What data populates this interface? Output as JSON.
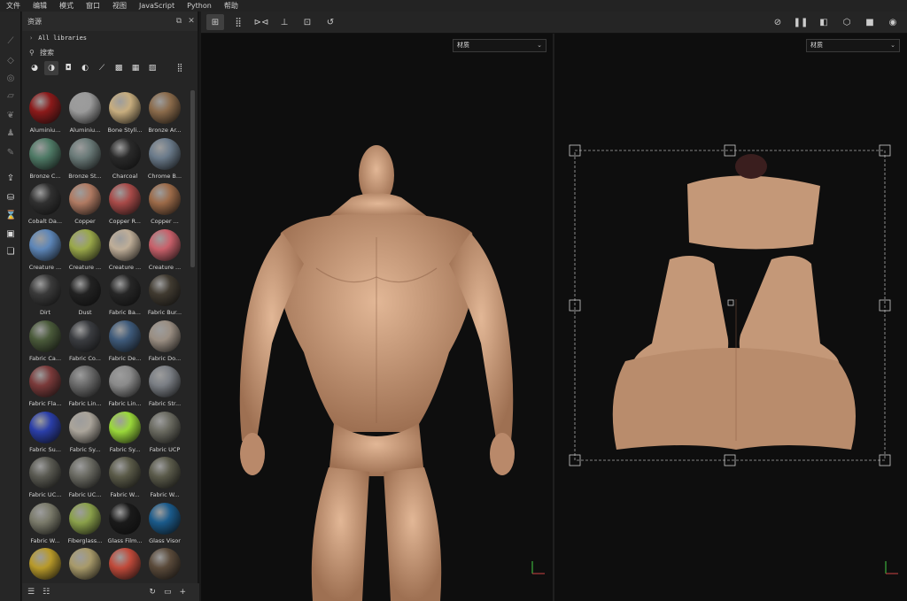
{
  "menu": [
    "文件",
    "编辑",
    "模式",
    "窗口",
    "视图",
    "JavaScript",
    "Python",
    "帮助"
  ],
  "assets": {
    "title": "资源",
    "library": "All libraries",
    "search_placeholder": "搜索",
    "materials": [
      {
        "name": "Aluminiu...",
        "color": "#8b1a1a"
      },
      {
        "name": "Aluminiu...",
        "color": "#9a9a9a"
      },
      {
        "name": "Bone Styli...",
        "color": "#c7ad7e"
      },
      {
        "name": "Bronze Ar...",
        "color": "#8a6a4a"
      },
      {
        "name": "Bronze C...",
        "color": "#4f7a66"
      },
      {
        "name": "Bronze St...",
        "color": "#6a7a78"
      },
      {
        "name": "Charcoal",
        "color": "#2a2a2a"
      },
      {
        "name": "Chrome B...",
        "color": "#6a7a8a"
      },
      {
        "name": "Cobalt Da...",
        "color": "#303030"
      },
      {
        "name": "Copper",
        "color": "#b07a62"
      },
      {
        "name": "Copper R...",
        "color": "#a84a48"
      },
      {
        "name": "Copper ...",
        "color": "#9c6a48"
      },
      {
        "name": "Creature ...",
        "color": "#5d86b8"
      },
      {
        "name": "Creature ...",
        "color": "#9aa84a"
      },
      {
        "name": "Creature ...",
        "color": "#bfae98"
      },
      {
        "name": "Creature ...",
        "color": "#c8606a"
      },
      {
        "name": "Dirt",
        "color": "#3a3a3a"
      },
      {
        "name": "Dust",
        "color": "#222222"
      },
      {
        "name": "Fabric Ba...",
        "color": "#262626"
      },
      {
        "name": "Fabric Bur...",
        "color": "#403a30"
      },
      {
        "name": "Fabric Ca...",
        "color": "#4a5a3a"
      },
      {
        "name": "Fabric Co...",
        "color": "#3a3c40"
      },
      {
        "name": "Fabric De...",
        "color": "#3e5a7a"
      },
      {
        "name": "Fabric Do...",
        "color": "#9a8e82"
      },
      {
        "name": "Fabric Fla...",
        "color": "#7a3a3a"
      },
      {
        "name": "Fabric Lin...",
        "color": "#6a6a6a"
      },
      {
        "name": "Fabric Lin...",
        "color": "#8a8a8a"
      },
      {
        "name": "Fabric Str...",
        "color": "#7a7e84"
      },
      {
        "name": "Fabric Su...",
        "color": "#2a3ea8"
      },
      {
        "name": "Fabric Sy...",
        "color": "#aaa49a"
      },
      {
        "name": "Fabric Sy...",
        "color": "#9ad83a"
      },
      {
        "name": "Fabric UCP",
        "color": "#6a6a60"
      },
      {
        "name": "Fabric UC...",
        "color": "#5a5a52"
      },
      {
        "name": "Fabric UC...",
        "color": "#6a6a62"
      },
      {
        "name": "Fabric W...",
        "color": "#5a5a48"
      },
      {
        "name": "Fabric W...",
        "color": "#5a5a4a"
      },
      {
        "name": "Fabric W...",
        "color": "#7a7a6a"
      },
      {
        "name": "Fiberglass...",
        "color": "#8aa04a"
      },
      {
        "name": "Glass Film...",
        "color": "#1a1a1a"
      },
      {
        "name": "Glass Visor",
        "color": "#1a5a8a"
      },
      {
        "name": "",
        "color": "#b89a2a"
      },
      {
        "name": "",
        "color": "#a89a6a"
      },
      {
        "name": "",
        "color": "#c04a3a"
      },
      {
        "name": "",
        "color": "#5a4a3a"
      }
    ]
  },
  "viewport3d": {
    "channel": "材质"
  },
  "viewport2d": {
    "channel": "材质"
  },
  "colors": {
    "skin": "#d6a886",
    "skin_shadow": "#a8785a",
    "accent": "#5a8cff"
  }
}
